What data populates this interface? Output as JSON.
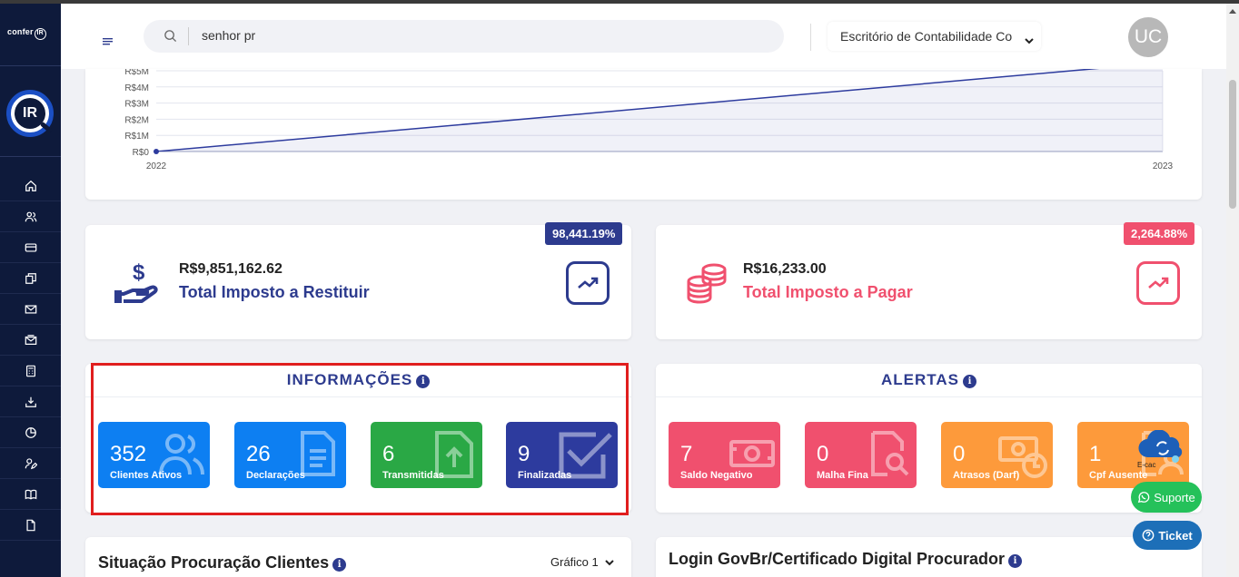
{
  "brand": {
    "small_logo_text": "confer",
    "small_logo_badge": "IR",
    "big_logo_text": "IR"
  },
  "header": {
    "search_value": "senhor pr",
    "office_label": "Escritório de Contabilidade Co",
    "avatar_initials": "UC"
  },
  "sidebar": {
    "items": [
      {
        "name": "home",
        "icon": "home-icon"
      },
      {
        "name": "clients",
        "icon": "users-icon"
      },
      {
        "name": "cards",
        "icon": "card-icon"
      },
      {
        "name": "documents",
        "icon": "copy-icon"
      },
      {
        "name": "mail",
        "icon": "mail-icon"
      },
      {
        "name": "mail-open",
        "icon": "mail-open-icon"
      },
      {
        "name": "calculator",
        "icon": "calculator-icon"
      },
      {
        "name": "download",
        "icon": "inbox-download-icon"
      },
      {
        "name": "reports",
        "icon": "pie-chart-icon"
      },
      {
        "name": "user-edit",
        "icon": "user-edit-icon"
      },
      {
        "name": "book",
        "icon": "book-icon"
      },
      {
        "name": "file",
        "icon": "file-icon"
      }
    ]
  },
  "chart_data": {
    "type": "area",
    "x": [
      "2022",
      "2023"
    ],
    "series": [
      {
        "values": [
          0,
          5500000
        ]
      }
    ],
    "ylim": [
      0,
      5000000
    ],
    "y_ticks": [
      "R$0",
      "R$1M",
      "R$2M",
      "R$3M",
      "R$4M",
      "R$5M"
    ],
    "x_ticks": [
      "2022",
      "2023"
    ],
    "line_color": "#2d3b9e",
    "grid": true
  },
  "restituir": {
    "amount": "R$9,851,162.62",
    "label": "Total Imposto a Restituir",
    "badge": "98,441.19%",
    "color": "#2d3b8e"
  },
  "pagar": {
    "amount": "R$16,233.00",
    "label": "Total Imposto a Pagar",
    "badge": "2,264.88%",
    "color": "#f0506e"
  },
  "informacoes": {
    "title": "INFORMAÇÕES",
    "info_glyph": "i",
    "tiles": [
      {
        "value": "352",
        "label": "Clientes Ativos",
        "color": "#0d7ff2",
        "icon": "users-icon"
      },
      {
        "value": "26",
        "label": "Declarações",
        "color": "#0d7ff2",
        "icon": "document-icon"
      },
      {
        "value": "6",
        "label": "Transmitidas",
        "color": "#2aa845",
        "icon": "upload-file-icon"
      },
      {
        "value": "9",
        "label": "Finalizadas",
        "color": "#2d3b9e",
        "icon": "check-square-icon"
      }
    ]
  },
  "alertas": {
    "title": "ALERTAS",
    "info_glyph": "i",
    "tiles": [
      {
        "value": "7",
        "label": "Saldo Negativo",
        "color": "#f0506e",
        "icon": "money-icon"
      },
      {
        "value": "0",
        "label": "Malha Fina",
        "color": "#f0506e",
        "icon": "file-search-icon"
      },
      {
        "value": "0",
        "label": "Atrasos (Darf)",
        "color": "#fd9a3b",
        "icon": "money-clock-icon"
      },
      {
        "value": "1",
        "label": "Cpf Ausente",
        "color": "#fd9a3b",
        "icon": "user-doc-icon"
      }
    ]
  },
  "procuracao": {
    "title": "Situação Procuração Clientes",
    "info_glyph": "i",
    "dropdown": "Gráfico 1"
  },
  "login": {
    "title": "Login GovBr/Certificado Digital Procurador",
    "info_glyph": "i"
  },
  "floating": {
    "ecac_label": "E-cac",
    "suporte": "Suporte",
    "ticket": "Ticket"
  }
}
